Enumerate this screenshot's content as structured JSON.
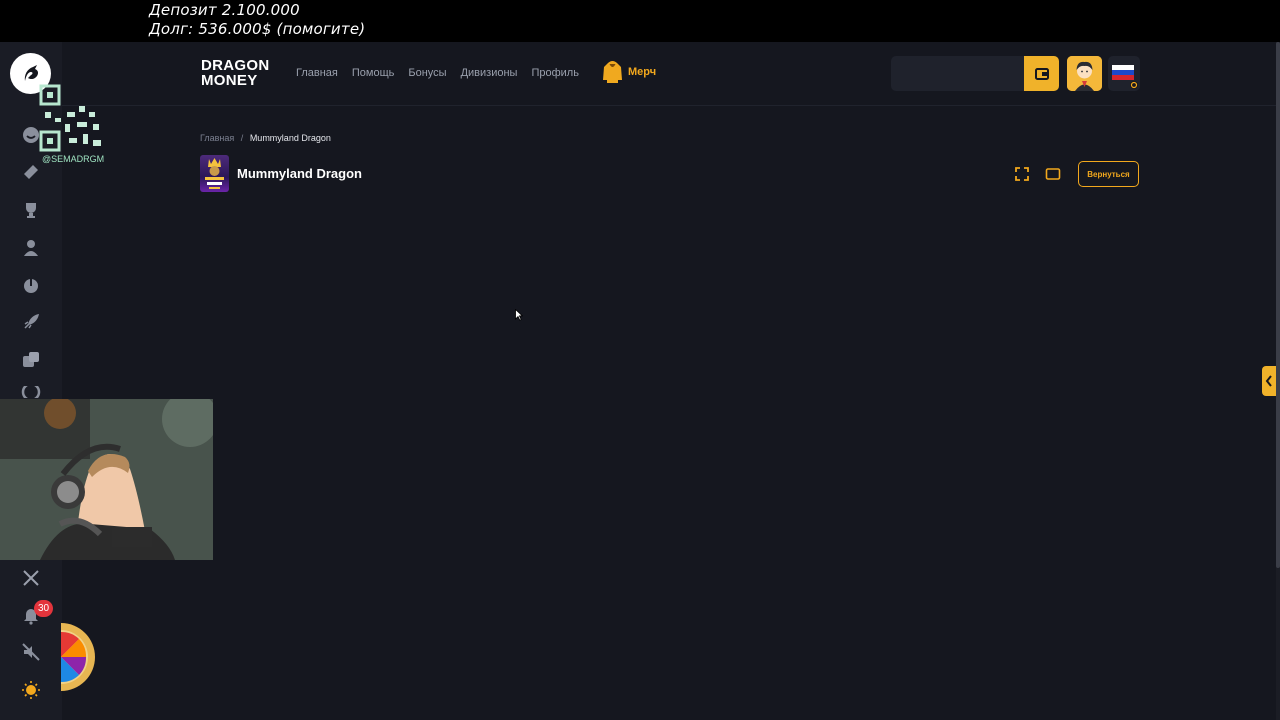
{
  "overlay": {
    "deposit_line": "Депозит 2.100.000",
    "debt_line": "Долг: 536.000$ (помогите)"
  },
  "qr": {
    "handle": "@SEMADRGM"
  },
  "header": {
    "brand_line1": "DRAGON",
    "brand_line2": "MONEY",
    "nav": [
      "Главная",
      "Помощь",
      "Бонусы",
      "Дивизионы",
      "Профиль"
    ],
    "merch_label": "Мерч",
    "search_value": ""
  },
  "breadcrumb": {
    "home": "Главная",
    "separator": "/",
    "current": "Mummyland Dragon"
  },
  "game": {
    "title": "Mummyland Dragon",
    "back_label": "Вернуться"
  },
  "sidebar": {
    "icons": [
      "logo-icon",
      "smile-icon",
      "ticket-icon",
      "trophy-icon",
      "user-icon",
      "joystick-icon",
      "rocket-icon",
      "dice-icon",
      "target-icon",
      "x-icon",
      "bell-icon",
      "mute-icon",
      "light-icon"
    ],
    "notification_count": "30"
  },
  "colors": {
    "accent": "#f2a81d",
    "background": "#15171f",
    "sidebar": "#1a1c25",
    "badge": "#e3343c"
  }
}
